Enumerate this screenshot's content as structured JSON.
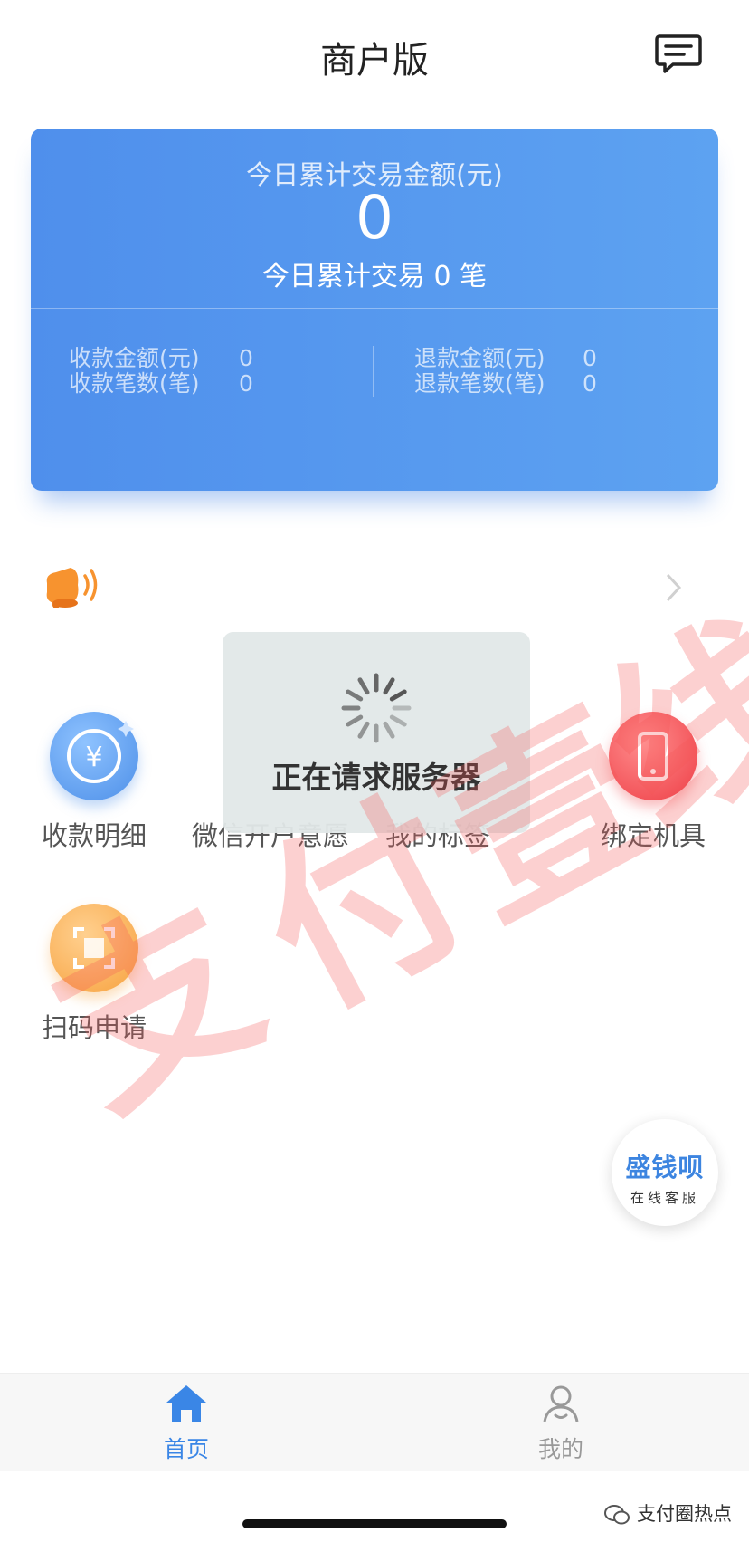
{
  "header": {
    "title": "商户版",
    "message_icon": "chat-bubble-icon"
  },
  "summary": {
    "today_amount_label": "今日累计交易金额(元)",
    "today_amount": "0",
    "today_count_text": "今日累计交易 0 笔",
    "receive_amount_label": "收款金额(元)",
    "receive_amount": "0",
    "receive_count_label": "收款笔数(笔)",
    "receive_count": "0",
    "refund_amount_label": "退款金额(元)",
    "refund_amount": "0",
    "refund_count_label": "退款笔数(笔)",
    "refund_count": "0"
  },
  "notice": {
    "icon": "bell-speaker-icon",
    "text": ""
  },
  "grid": [
    {
      "label": "收款明细",
      "icon": "yen-coin-icon"
    },
    {
      "label": "微信开户意愿",
      "icon": ""
    },
    {
      "label": "我的标签",
      "icon": ""
    },
    {
      "label": "绑定机具",
      "icon": "phone-icon"
    },
    {
      "label": "扫码申请",
      "icon": "scan-icon"
    }
  ],
  "toast": {
    "text": "正在请求服务器"
  },
  "customer_service": {
    "brand": "盛钱呗",
    "subtitle": "在线客服"
  },
  "tabs": [
    {
      "label": "首页",
      "icon": "home-icon",
      "active": true
    },
    {
      "label": "我的",
      "icon": "user-icon",
      "active": false
    }
  ],
  "watermark": {
    "chars": [
      "支",
      "付",
      "壹",
      "线"
    ]
  },
  "footer": {
    "account": "支付圈热点"
  },
  "colors": {
    "primary": "#4f8fec",
    "active_tab": "#3a86e6",
    "inactive_tab": "#999999"
  }
}
